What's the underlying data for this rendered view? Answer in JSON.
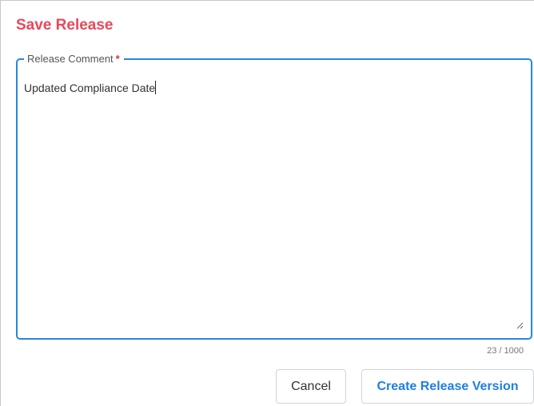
{
  "dialog": {
    "title": "Save Release",
    "comment_field": {
      "label": "Release Comment",
      "required_marker": "*",
      "value": "Updated Compliance Date",
      "char_count": "23 / 1000"
    },
    "buttons": {
      "cancel_label": "Cancel",
      "create_label": "Create Release Version"
    }
  },
  "colors": {
    "title": "#e8485a",
    "focus_border": "#2a86e0",
    "primary_text": "#1f7fe0",
    "required": "#d8333f"
  },
  "icons": {
    "resize": "resize-handle-icon"
  }
}
